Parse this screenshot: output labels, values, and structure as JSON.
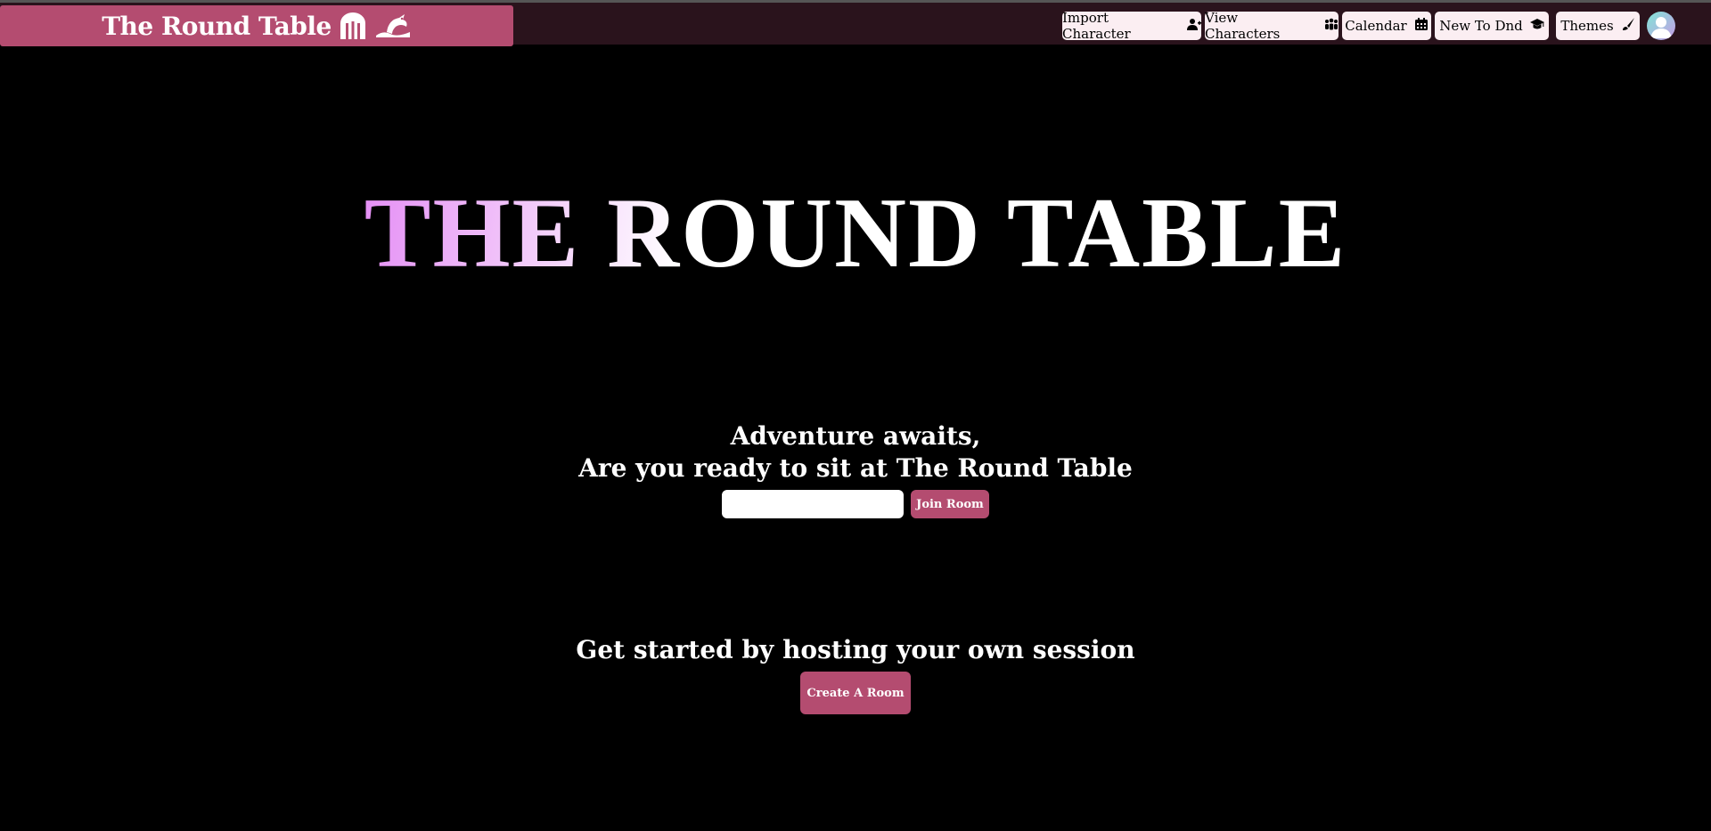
{
  "brand": {
    "title": "The Round Table"
  },
  "nav": [
    {
      "label": "Import Character",
      "icon": "user-plus-icon"
    },
    {
      "label": "View Characters",
      "icon": "users-icon"
    },
    {
      "label": "Calendar",
      "icon": "calendar-icon"
    },
    {
      "label": "New To Dnd",
      "icon": "graduation-cap-icon"
    },
    {
      "label": "Themes",
      "icon": "paint-brush-icon"
    }
  ],
  "hero": {
    "title": "THE ROUND TABLE"
  },
  "join": {
    "line1": "Adventure awaits,",
    "line2": "Are you ready to sit at The Round Table",
    "input_value": "",
    "button": "Join Room"
  },
  "host": {
    "text": "Get started by hosting your own session",
    "button": "Create A Room"
  },
  "colors": {
    "accent": "#b44c70",
    "topbar": "#2a131c",
    "background": "#000000"
  }
}
